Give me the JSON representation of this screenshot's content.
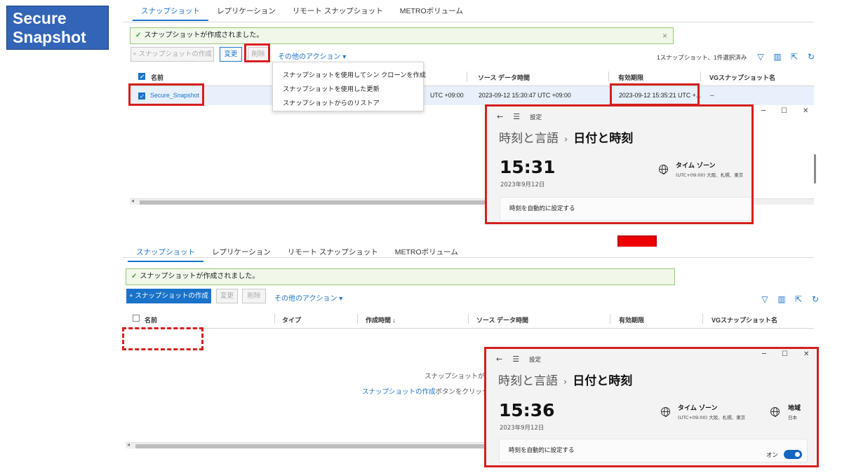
{
  "title_badge": "Secure Snapshot",
  "tabs": [
    "スナップショット",
    "レプリケーション",
    "リモート スナップショット",
    "METROボリューム"
  ],
  "alert": {
    "message": "スナップショットが作成されました。",
    "close": "×"
  },
  "toolbar": {
    "create": "+ スナップショットの作成",
    "modify": "変更",
    "delete": "削除",
    "more_actions": "その他のアクション ▾",
    "selection_status": "1スナップショット、1件選択済み"
  },
  "columns": {
    "name": "名前",
    "type": "タイプ",
    "created": "作成時間 ↓",
    "source_time": "ソース データ時間",
    "expiry": "有効期限",
    "vg_name": "VGスナップショット名"
  },
  "before": {
    "row": {
      "name": "Secure_Snapshot",
      "created_partial": "UTC +09:00",
      "source_time": "2023-09-12 15:30:47 UTC +09:00",
      "expiry": "2023-09-12 15:35:21 UTC +...",
      "vg_name": "--"
    },
    "menu": [
      "スナップショットを使用してシン クローンを作成",
      "スナップショットを使用した更新",
      "スナップショットからのリストア"
    ],
    "clock": {
      "time": "15:31",
      "date": "2023年9月12日"
    }
  },
  "after": {
    "empty_message": "スナップショットがあ",
    "empty_hint_link": "スナップショットの作成",
    "empty_hint_text": "ボタンをクリックし",
    "clock": {
      "time": "15:36",
      "date": "2023年9月12日"
    }
  },
  "settings": {
    "nav_label": "設定",
    "crumb_parent": "時刻と言語",
    "crumb_current": "日付と時刻",
    "timezone_title": "タイム ゾーン",
    "timezone_value": "(UTC+09:00) 大阪、札幌、東京",
    "region_title": "地域",
    "region_value": "日本",
    "auto_time_label": "時刻を自動的に設定する",
    "toggle_state": "オン"
  },
  "colors": {
    "accent": "#1a73c9",
    "highlight": "#d61f1f",
    "badge": "#3264b8"
  }
}
